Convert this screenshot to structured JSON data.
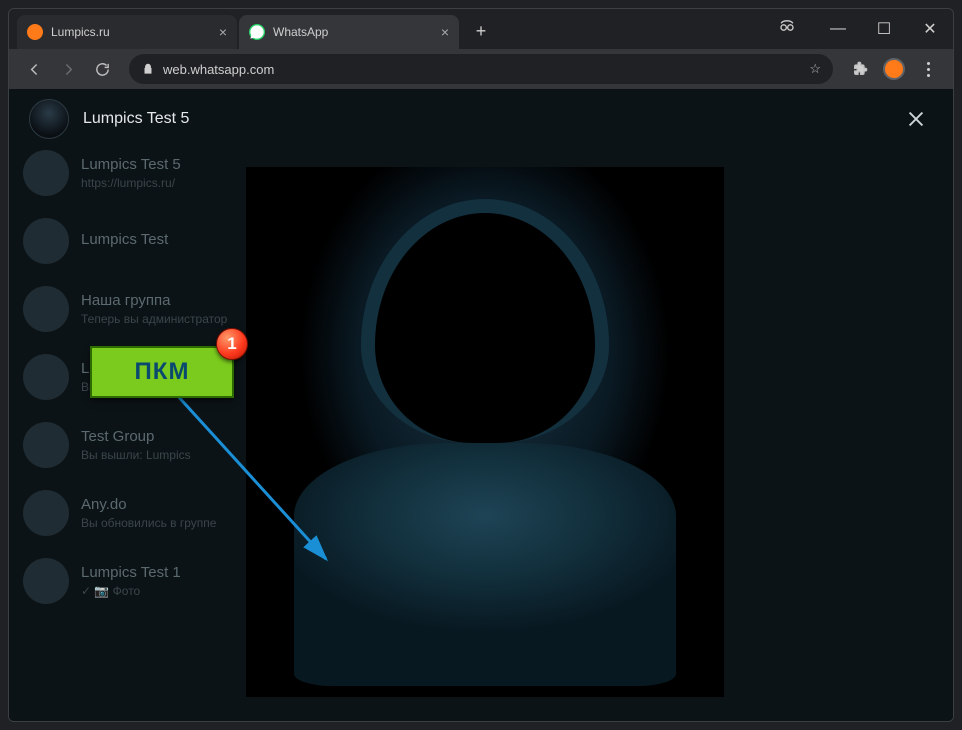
{
  "browser": {
    "tabs": [
      {
        "title": "Lumpics.ru",
        "favicon": "orange",
        "active": false
      },
      {
        "title": "WhatsApp",
        "favicon": "wa",
        "active": true
      }
    ],
    "url": "web.whatsapp.com",
    "window_controls": {
      "min": "—",
      "max": "☐",
      "close": "✕"
    }
  },
  "viewer": {
    "contact_name": "Lumpics Test 5"
  },
  "chat_list": [
    {
      "title": "Lumpics Test 5",
      "subtitle": "https://lumpics.ru/"
    },
    {
      "title": "Lumpics Test",
      "subtitle": ""
    },
    {
      "title": "Наша группа",
      "subtitle": "Теперь вы администратор"
    },
    {
      "title": "Lumpics Test 2",
      "subtitle": "Вы обновились в группе"
    },
    {
      "title": "Test Group",
      "subtitle": "Вы вышли: Lumpics"
    },
    {
      "title": "Any.do",
      "subtitle": "Вы обновились в группе"
    },
    {
      "title": "Lumpics Test 1",
      "subtitle": "✓ 📷 Фото"
    }
  ],
  "annotation": {
    "label": "ПКМ",
    "badge": "1"
  }
}
